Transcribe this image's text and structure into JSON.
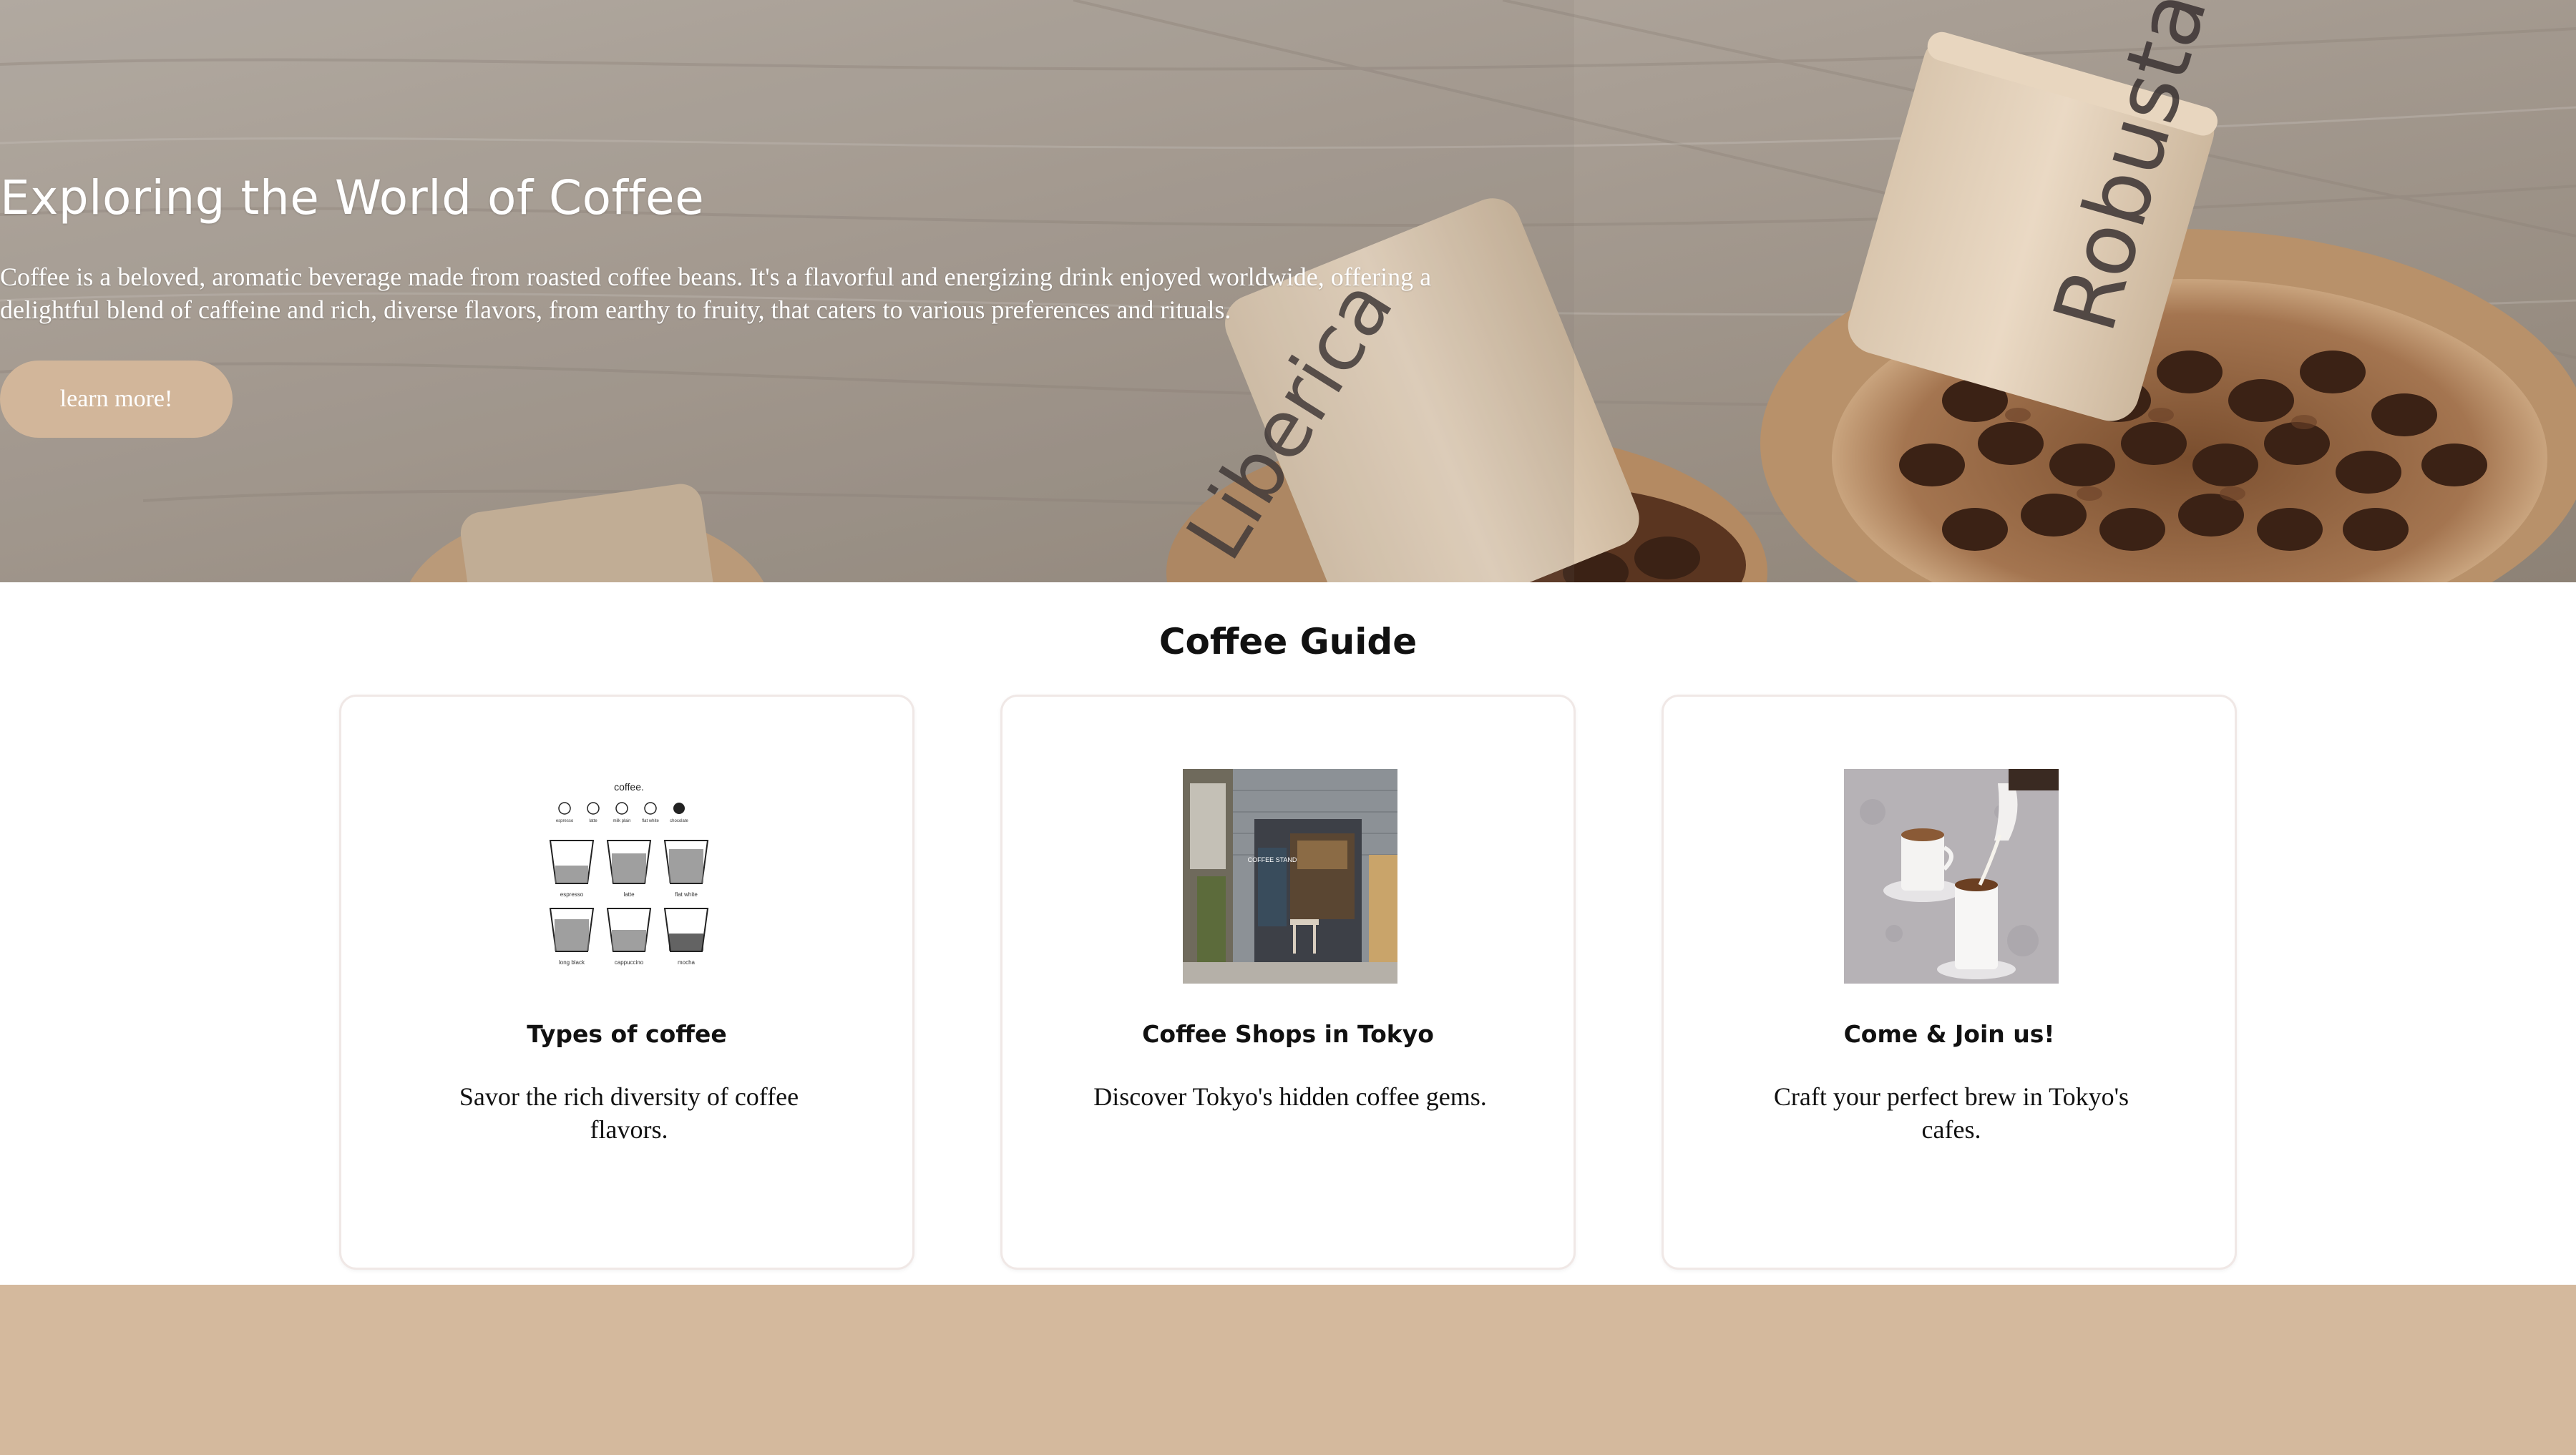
{
  "hero": {
    "title": "Exploring the World of Coffee",
    "description": "Coffee is a beloved, aromatic beverage made from roasted coffee beans. It's a flavorful and energizing drink enjoyed worldwide, offering a delightful blend of caffeine and rich, diverse flavors, from earthy to fruity, that caters to various preferences and rituals.",
    "button_label": "learn more!",
    "scroll_labels": [
      "Liberica",
      "Robusta"
    ]
  },
  "guide": {
    "title": "Coffee Guide",
    "cards": [
      {
        "title": "Types of coffee",
        "description": "Savor the rich diversity of coffee flavors."
      },
      {
        "title": "Coffee Shops in Tokyo",
        "description": "Discover Tokyo's hidden coffee gems."
      },
      {
        "title": "Come & Join us!",
        "description": "Craft your perfect brew in Tokyo's cafes."
      }
    ]
  },
  "illustration": {
    "heading": "coffee.",
    "bean_labels": [
      "espresso",
      "latte",
      "milk plain",
      "flat white",
      "chocolate"
    ],
    "cup_labels": [
      "espresso",
      "latte",
      "flat white",
      "long black",
      "cappuccino",
      "mocha"
    ]
  },
  "shop_sign": "COFFEE STAND",
  "colors": {
    "accent": "#d2b69a",
    "footer": "#d4b99d",
    "card_border": "#f0e8e6"
  }
}
